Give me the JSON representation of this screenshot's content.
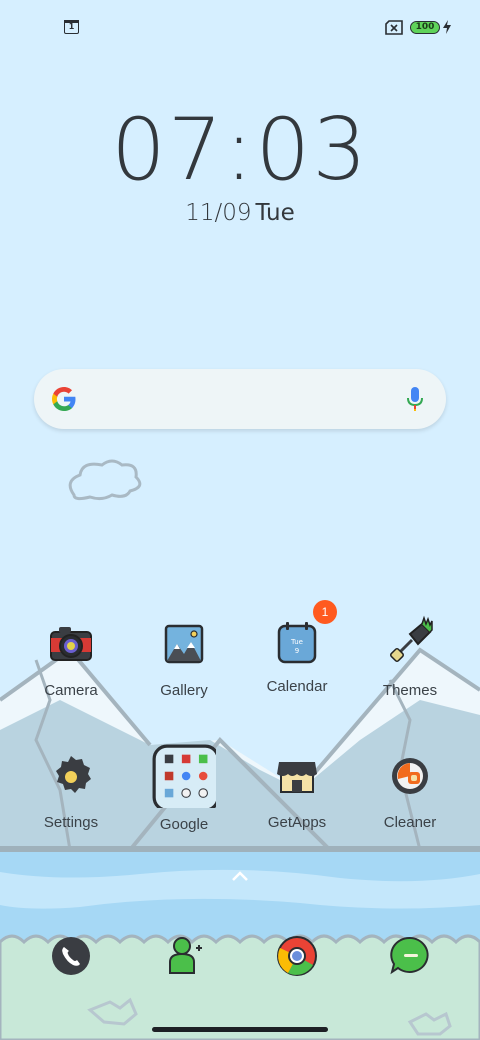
{
  "status": {
    "notification_count": "1",
    "battery_level": "100"
  },
  "clock": {
    "time": "07:03",
    "date": "11/09",
    "day": "Tue"
  },
  "search": {
    "placeholder": ""
  },
  "apps": {
    "camera": "Camera",
    "gallery": "Gallery",
    "calendar": "Calendar",
    "calendar_badge": "1",
    "calendar_icon_day": "Tue",
    "calendar_icon_date": "9",
    "themes": "Themes",
    "settings": "Settings",
    "google": "Google",
    "getapps": "GetApps",
    "cleaner": "Cleaner"
  },
  "dock": {
    "phone": "phone-icon",
    "contacts": "contacts-icon",
    "chrome": "chrome-icon",
    "messages": "messages-icon"
  },
  "colors": {
    "sky": "#d6efff",
    "mountain": "#b9d3e0",
    "water": "#a6d8f5",
    "ground": "#c8e8d8",
    "badge": "#ff5a1f"
  }
}
